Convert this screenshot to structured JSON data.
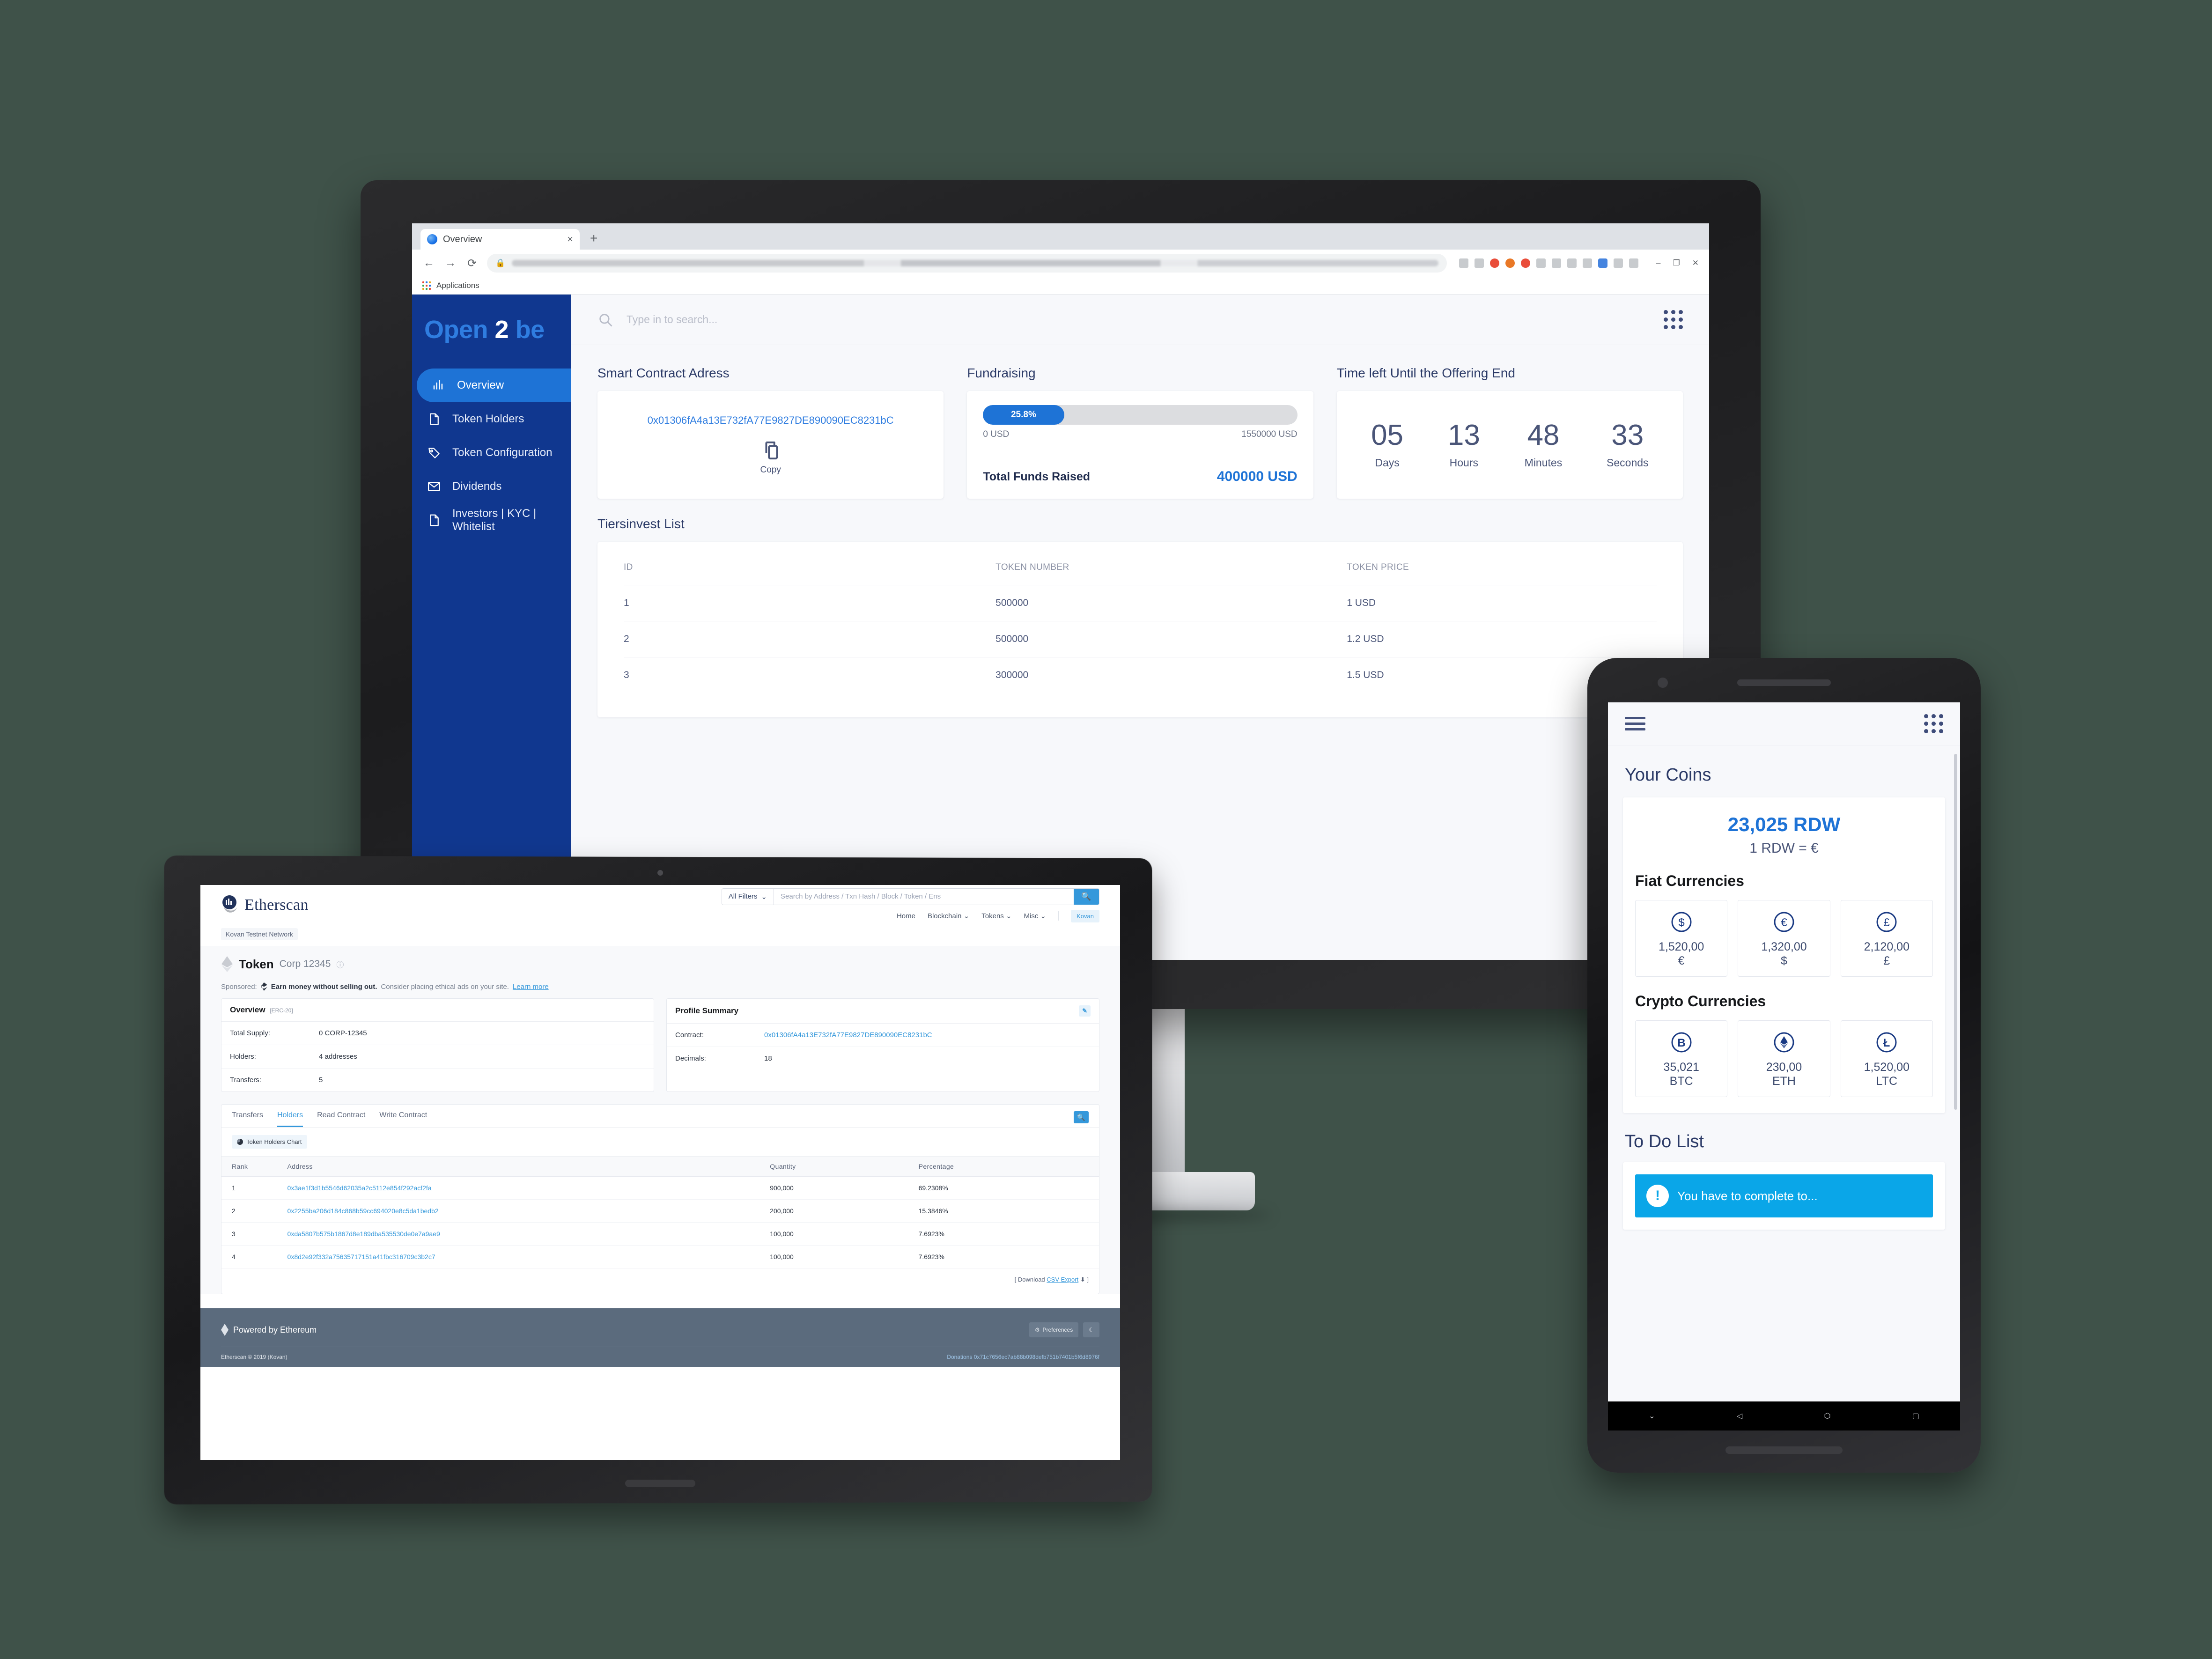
{
  "browser": {
    "tab_title": "Overview",
    "tab_close": "×",
    "new_tab": "+",
    "back": "←",
    "forward": "→",
    "reload": "⟳",
    "lock": "🔒",
    "bookmark_label": "Applications",
    "minimize": "–",
    "maximize": "❐",
    "close": "✕"
  },
  "app": {
    "brand": {
      "word1": "Open",
      "word2": "2",
      "word3": "be"
    },
    "sidebar": {
      "items": [
        {
          "label": "Overview",
          "icon": "bar-chart-icon",
          "active": true
        },
        {
          "label": "Token Holders",
          "icon": "document-icon",
          "active": false
        },
        {
          "label": "Token Configuration",
          "icon": "tag-icon",
          "active": false
        },
        {
          "label": "Dividends",
          "icon": "envelope-icon",
          "active": false
        },
        {
          "label": "Investors | KYC | Whitelist",
          "icon": "document-icon",
          "active": false
        }
      ]
    },
    "topbar": {
      "search_placeholder": "Type in to search...",
      "grid_icon": "apps-grid-icon"
    },
    "contract": {
      "title": "Smart Contract Adress",
      "address": "0x01306fA4a13E732fA77E9827DE890090EC8231bC",
      "copy_label": "Copy"
    },
    "fundraising": {
      "title": "Fundraising",
      "percent_label": "25.8%",
      "percent_value": 25.8,
      "min_label": "0 USD",
      "max_label": "1550000 USD",
      "total_label": "Total Funds Raised",
      "total_value": "400000 USD"
    },
    "countdown": {
      "title": "Time left Until the Offering End",
      "units": [
        {
          "value": "05",
          "label": "Days"
        },
        {
          "value": "13",
          "label": "Hours"
        },
        {
          "value": "48",
          "label": "Minutes"
        },
        {
          "value": "33",
          "label": "Seconds"
        }
      ]
    },
    "tiers": {
      "title": "Tiersinvest List",
      "columns": [
        "ID",
        "TOKEN NUMBER",
        "TOKEN PRICE"
      ],
      "rows": [
        {
          "id": "1",
          "token_number": "500000",
          "token_price": "1 USD"
        },
        {
          "id": "2",
          "token_number": "500000",
          "token_price": "1.2 USD"
        },
        {
          "id": "3",
          "token_number": "300000",
          "token_price": "1.5 USD"
        }
      ]
    }
  },
  "etherscan": {
    "brand": "Etherscan",
    "network_pill": "Kovan Testnet Network",
    "filter_label": "All Filters",
    "search_placeholder": "Search by Address / Txn Hash / Block / Token / Ens",
    "search_icon": "search-icon",
    "nav": [
      "Home",
      "Blockchain",
      "Tokens",
      "Misc"
    ],
    "network_chip": "Kovan",
    "page_title": "Token",
    "page_subtitle": "Corp 12345",
    "sponsored": {
      "prefix": "Sponsored:",
      "bold": "Earn money without selling out.",
      "rest": "Consider placing ethical ads on your site.",
      "link": "Learn more"
    },
    "overview_card": {
      "title": "Overview",
      "badge": "[ERC-20]",
      "rows": [
        {
          "key": "Total Supply:",
          "value": "0 CORP-12345"
        },
        {
          "key": "Holders:",
          "value": "4 addresses"
        },
        {
          "key": "Transfers:",
          "value": "5"
        }
      ]
    },
    "profile_card": {
      "title": "Profile Summary",
      "edit_icon": "pencil-icon",
      "rows": [
        {
          "key": "Contract:",
          "value": "0x01306fA4a13E732fA77E9827DE890090EC8231bC",
          "link": true
        },
        {
          "key": "Decimals:",
          "value": "18",
          "link": false
        }
      ]
    },
    "tabs": [
      "Transfers",
      "Holders",
      "Read Contract",
      "Write Contract"
    ],
    "active_tab": "Holders",
    "chart_button": "Token Holders Chart",
    "holders_columns": [
      "Rank",
      "Address",
      "Quantity",
      "Percentage"
    ],
    "holders": [
      {
        "rank": "1",
        "address": "0x3ae1f3d1b5546d62035a2c5112e854f292acf2fa",
        "quantity": "900,000",
        "percentage": "69.2308%"
      },
      {
        "rank": "2",
        "address": "0x2255ba206d184c868b59cc694020e8c5da1bedb2",
        "quantity": "200,000",
        "percentage": "15.3846%"
      },
      {
        "rank": "3",
        "address": "0xda5807b575b1867d8e189dba535530de0e7a9ae9",
        "quantity": "100,000",
        "percentage": "7.6923%"
      },
      {
        "rank": "4",
        "address": "0x8d2e92f332a75635717151a41fbc316709c3b2c7",
        "quantity": "100,000",
        "percentage": "7.6923%"
      }
    ],
    "csv_prefix": "[ Download",
    "csv_link": "CSV Export",
    "csv_suffix": "]",
    "footer": {
      "powered": "Powered by Ethereum",
      "preferences": "Preferences",
      "theme_icon": "moon-icon",
      "copyright": "Etherscan © 2019 (Kovan)",
      "donations_label": "Donations",
      "donations_address": "0x71c7656ec7ab88b098defb751b7401b5f6d8976f"
    }
  },
  "mobile": {
    "menu_icon": "hamburger-icon",
    "grid_icon": "apps-grid-icon",
    "coins_title": "Your Coins",
    "balance": "23,025 RDW",
    "rate": "1 RDW = €",
    "fiat_title": "Fiat Currencies",
    "fiat": [
      {
        "symbol": "$",
        "icon": "dollar-coin-icon",
        "value": "1,520,00",
        "unit": "€"
      },
      {
        "symbol": "€",
        "icon": "euro-coin-icon",
        "value": "1,320,00",
        "unit": "$"
      },
      {
        "symbol": "£",
        "icon": "pound-coin-icon",
        "value": "2,120,00",
        "unit": "£"
      }
    ],
    "crypto_title": "Crypto Currencies",
    "crypto": [
      {
        "symbol": "Ƀ",
        "icon": "bitcoin-coin-icon",
        "value": "35,021",
        "unit": "BTC"
      },
      {
        "symbol": "Ξ",
        "icon": "ethereum-coin-icon",
        "value": "230,00",
        "unit": "ETH"
      },
      {
        "symbol": "Ł",
        "icon": "litecoin-coin-icon",
        "value": "1,520,00",
        "unit": "LTC"
      }
    ],
    "todo_title": "To Do List",
    "todo_item": "You have to complete to...",
    "todo_badge": "!",
    "navbar": {
      "collapse": "⌄",
      "back": "◁",
      "home": "⬡",
      "recents": "▢"
    }
  },
  "colors": {
    "sidebar_blue": "#10378f",
    "accent_blue": "#1e73d6",
    "etherscan_blue": "#3498db",
    "footer_slate": "#5b6b7d",
    "background": "#3f5249"
  }
}
